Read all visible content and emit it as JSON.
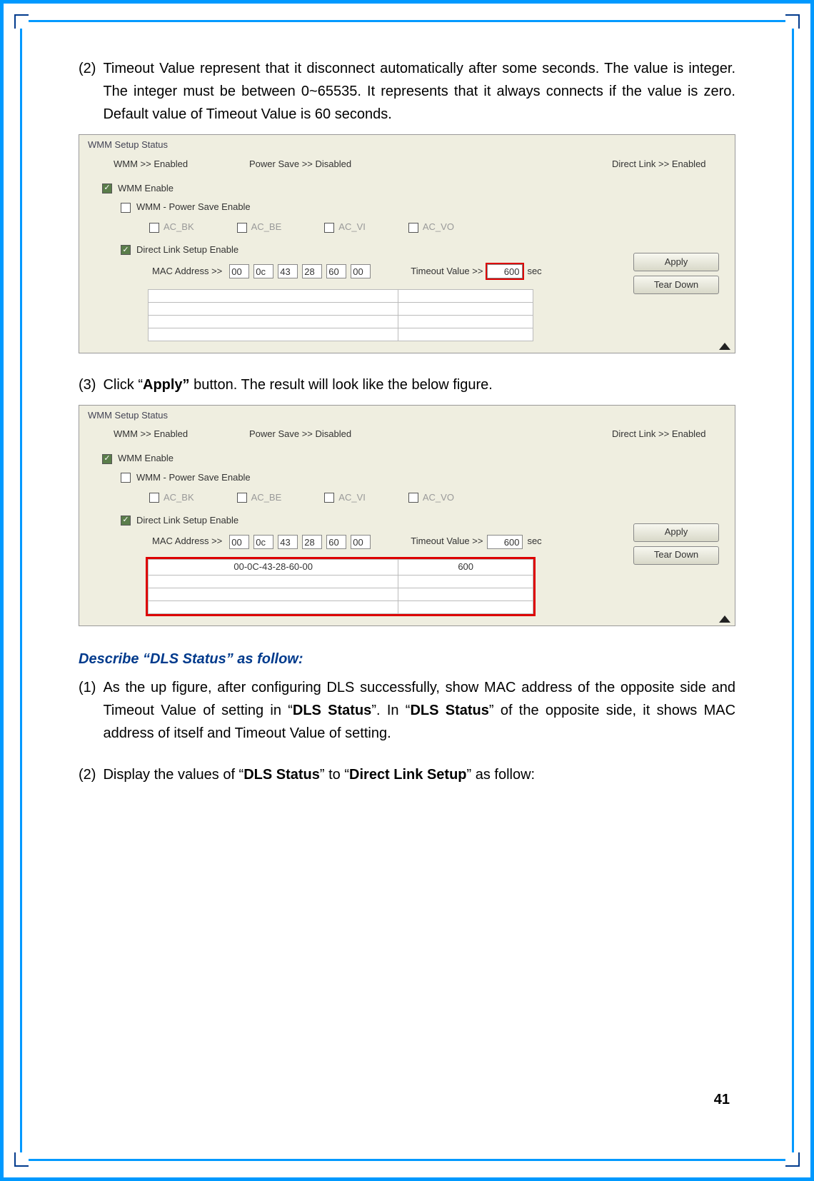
{
  "body": {
    "item2_num": "(2)",
    "item2_text": "Timeout Value represent that it disconnect automatically after some seconds. The value is integer. The integer must be between 0~65535. It represents that it always connects if the value is zero. Default value of Timeout Value is 60 seconds.",
    "item3_num": "(3)",
    "item3_pre": "Click “",
    "item3_bold": "Apply”",
    "item3_post": " button. The result will look like the below figure.",
    "section_title": "Describe “DLS Status” as follow:",
    "dls1_num": "(1)",
    "dls1_p1": "As the up figure, after configuring DLS successfully, show MAC address of the opposite side and Timeout Value of setting in “",
    "dls1_b1": "DLS Status",
    "dls1_p2": "”. In “",
    "dls1_b2": "DLS Status",
    "dls1_p3": "” of the opposite side, it shows MAC address of itself and Timeout Value of setting.",
    "dls2_num": "(2)",
    "dls2_p1": "Display the values of “",
    "dls2_b1": "DLS Status",
    "dls2_p2": "” to “",
    "dls2_b2": "Direct Link Setup",
    "dls2_p3": "” as follow:"
  },
  "panel": {
    "fieldset_title": "WMM Setup Status",
    "status_wmm": "WMM >> Enabled",
    "status_ps": "Power Save >> Disabled",
    "status_dl": "Direct Link >> Enabled",
    "wmm_enable": "WMM Enable",
    "wmm_ps": "WMM - Power Save Enable",
    "ac_bk": "AC_BK",
    "ac_be": "AC_BE",
    "ac_vi": "AC_VI",
    "ac_vo": "AC_VO",
    "dls_enable": "Direct Link Setup Enable",
    "mac_label": "MAC Address >>",
    "mac": [
      "00",
      "0c",
      "43",
      "28",
      "60",
      "00"
    ],
    "timeout_label": "Timeout Value >>",
    "timeout_value": "600",
    "timeout_unit": "sec",
    "btn_apply": "Apply",
    "btn_teardown": "Tear Down",
    "table_row1_mac": "00-0C-43-28-60-00",
    "table_row1_to": "600"
  },
  "page_number": "41"
}
